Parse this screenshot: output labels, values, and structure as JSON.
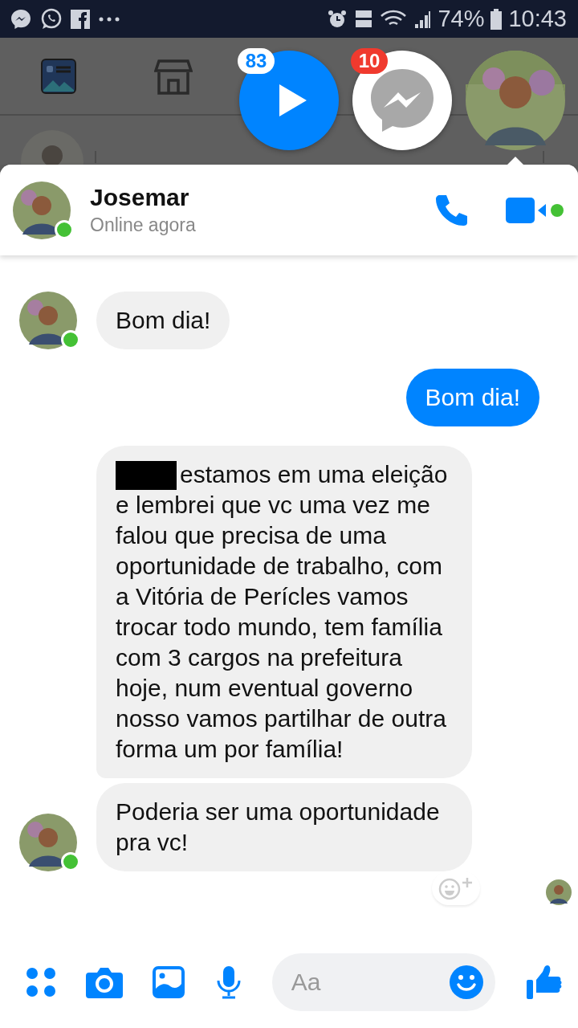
{
  "status_bar": {
    "battery": "74%",
    "time": "10:43"
  },
  "chat_heads": [
    {
      "kind": "video",
      "badge": "83"
    },
    {
      "kind": "messenger",
      "badge": "10"
    },
    {
      "kind": "contact"
    }
  ],
  "conversation": {
    "name": "Josemar",
    "status": "Online agora",
    "online": true
  },
  "messages": [
    {
      "kind": "incoming",
      "text": "Bom dia!",
      "avatar": true,
      "redacted": false
    },
    {
      "kind": "outgoing",
      "text": "Bom dia!",
      "avatar": false,
      "redacted": false
    },
    {
      "kind": "incoming",
      "text": "estamos em uma eleição e lembrei que vc uma vez me falou que precisa de uma oportunidade de trabalho, com a Vitória de Perícles vamos trocar todo mundo, tem família com 3 cargos na prefeitura hoje, num eventual governo nosso vamos partilhar de outra forma um por família!",
      "avatar": false,
      "redacted": true
    },
    {
      "kind": "incoming",
      "text": "Poderia ser uma oportunidade pra vc!",
      "avatar": true,
      "redacted": false
    }
  ],
  "composer": {
    "placeholder": "Aa"
  }
}
